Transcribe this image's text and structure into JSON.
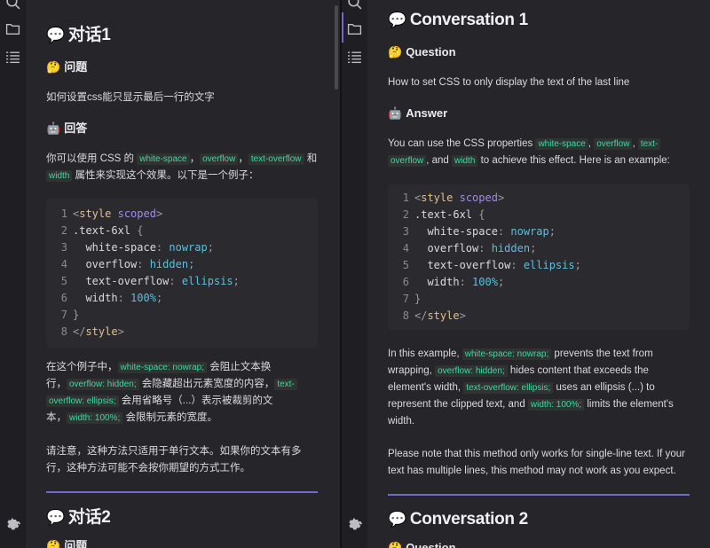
{
  "left": {
    "c1_title": "对话1",
    "q_heading": "问题",
    "question": "如何设置css能只显示最后一行的文字",
    "a_heading": "回答",
    "ans1": [
      "你可以使用 CSS 的 ",
      "white-space",
      "，",
      "overflow",
      "，",
      "text-overflow",
      " 和"
    ],
    "ans2": [
      "width",
      " 属性来实现这个效果。以下是一个例子："
    ],
    "para1_l1": [
      "在这个例子中，",
      "white-space: nowrap;",
      " 会阻止文本换"
    ],
    "para1_l2": [
      "行，",
      "overflow: hidden;",
      " 会隐藏超出元素宽度的内容，",
      "text-"
    ],
    "para1_l3": [
      "overflow: ellipsis;",
      " 会用省略号（...）表示被裁剪的文"
    ],
    "para1_l4": [
      "本，",
      "width: 100%;",
      " 会限制元素的宽度。"
    ],
    "para2_l1": "请注意，这种方法只适用于单行文本。如果你的文本有多",
    "para2_l2": "行，这种方法可能不会按你期望的方式工作。",
    "c2_title": "对话2",
    "c2_q_heading": "问题"
  },
  "right": {
    "c1_title": "Conversation 1",
    "q_heading": "Question",
    "question": "How to set CSS to only display the text of the last line",
    "a_heading": "Answer",
    "ans1": [
      "You can use the CSS properties ",
      "white-space",
      ", ",
      "overflow",
      ", ",
      "text-"
    ],
    "ans2": [
      "overflow",
      ", and ",
      "width",
      " to achieve this effect. Here is an example:"
    ],
    "p1_l1": [
      "In this example, ",
      "white-space: nowrap;",
      " prevents the text from"
    ],
    "p1_l2": [
      "wrapping, ",
      "overflow: hidden;",
      " hides content that exceeds the"
    ],
    "p1_l3": [
      "element's width, ",
      "text-overflow: ellipsis;",
      " uses an ellipsis (...) to"
    ],
    "p1_l4": [
      "represent the clipped text, and ",
      "width: 100%;",
      " limits the element's"
    ],
    "p1_l5": "width.",
    "p2_l1": "Please note that this method only works for single-line text. If your",
    "p2_l2": "text has multiple lines, this method may not work as you expect.",
    "c2_title": "Conversation 2",
    "c2_q_heading": "Question"
  },
  "code": [
    {
      "n": "1",
      "parts": [
        [
          "t-pun",
          "<"
        ],
        [
          "t-tag",
          "style "
        ],
        [
          "t-attr",
          "scoped"
        ],
        [
          "t-pun",
          ">"
        ]
      ]
    },
    {
      "n": "2",
      "parts": [
        [
          "t-sel",
          ".text-6xl "
        ],
        [
          "t-pun",
          "{"
        ]
      ]
    },
    {
      "n": "3",
      "parts": [
        [
          "t-prop",
          "  white-space"
        ],
        [
          "t-pun",
          ": "
        ],
        [
          "t-val",
          "nowrap"
        ],
        [
          "t-pun",
          ";"
        ]
      ]
    },
    {
      "n": "4",
      "parts": [
        [
          "t-prop",
          "  overflow"
        ],
        [
          "t-pun",
          ": "
        ],
        [
          "t-val",
          "hidden"
        ],
        [
          "t-pun",
          ";"
        ]
      ]
    },
    {
      "n": "5",
      "parts": [
        [
          "t-prop",
          "  text-overflow"
        ],
        [
          "t-pun",
          ": "
        ],
        [
          "t-val",
          "ellipsis"
        ],
        [
          "t-pun",
          ";"
        ]
      ]
    },
    {
      "n": "6",
      "parts": [
        [
          "t-prop",
          "  width"
        ],
        [
          "t-pun",
          ": "
        ],
        [
          "t-val",
          "100%"
        ],
        [
          "t-pun",
          ";"
        ]
      ]
    },
    {
      "n": "7",
      "parts": [
        [
          "t-pun",
          "}"
        ]
      ]
    },
    {
      "n": "8",
      "parts": [
        [
          "t-pun",
          "</"
        ],
        [
          "t-tag",
          "style"
        ],
        [
          "t-pun",
          ">"
        ]
      ]
    }
  ],
  "emoji": {
    "speech": "💬",
    "thinking": "🤔",
    "robot": "🤖"
  },
  "icons": [
    "search-icon",
    "folder-icon",
    "list-icon",
    "gear-icon"
  ],
  "colors": {
    "accent": "#6e6acb",
    "code_inline": "#3fd6a8",
    "background": "#26262a"
  }
}
